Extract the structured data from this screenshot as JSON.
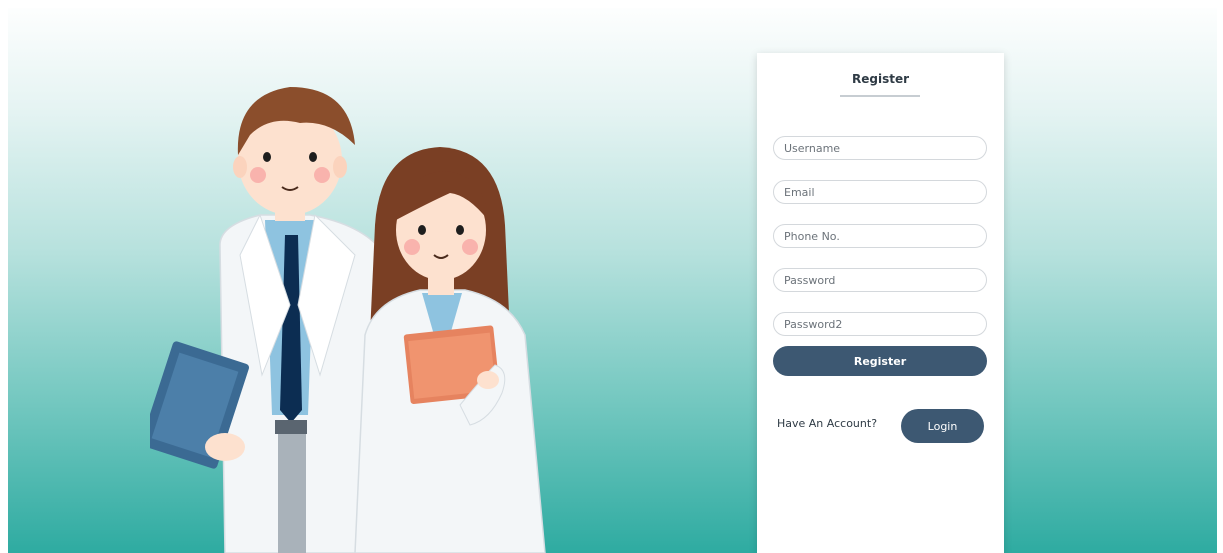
{
  "register_form": {
    "title": "Register",
    "username_placeholder": "Username",
    "email_placeholder": "Email",
    "phone_placeholder": "Phone No.",
    "password_placeholder": "Password",
    "password2_placeholder": "Password2",
    "register_button_label": "Register",
    "have_account_text": "Have An Account?",
    "login_button_label": "Login"
  },
  "colors": {
    "primary_button": "#3d5872",
    "background_top": "#fdfefe",
    "background_bottom": "#2eaba1"
  },
  "illustration": {
    "icon": "doctors-illustration"
  }
}
